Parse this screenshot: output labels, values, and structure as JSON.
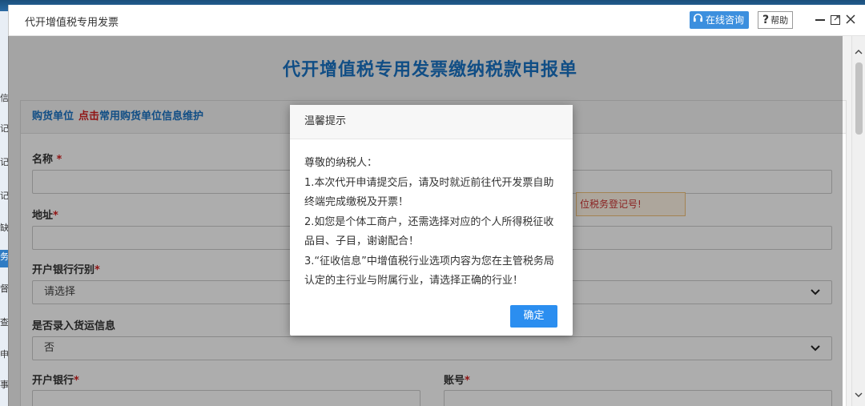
{
  "window": {
    "title": "代开增值税专用发票",
    "consult_label": "在线咨询",
    "help_label": "帮助",
    "help_symbol": "?"
  },
  "form": {
    "title": "代开增值税专用发票缴纳税款申报单",
    "panel_title": "购货单位",
    "panel_link_red": "点击",
    "panel_link": "常用购货单位信息维护",
    "name_label": "名称",
    "address_label": "地址",
    "bank_type_label": "开户银行行别",
    "bank_type_value": "请选择",
    "shipping_label": "是否录入货运信息",
    "shipping_value": "否",
    "bank_label": "开户银行",
    "account_label": "账号",
    "required_mark": "*",
    "warning_text": "位税务登记号!"
  },
  "dialog": {
    "title": "温馨提示",
    "lines": [
      "尊敬的纳税人：",
      "1.本次代开申请提交后，请及时就近前往代开发票自助终端完成缴税及开票！",
      "2.如您是个体工商户，还需选择对应的个人所得税征收品目、子目，谢谢配合！",
      "3.“征收信息”中增值税行业选项内容为您在主管税务局认定的主行业与附属行业，请选择正确的行业！"
    ],
    "ok_label": "确定"
  },
  "background_left": [
    "信",
    "记",
    "记",
    "记",
    "缺",
    "务",
    "督",
    "查",
    "申",
    "事"
  ],
  "colors": {
    "accent": "#1a73c5",
    "required": "#d62020",
    "button": "#2b8ef0"
  },
  "icons": {
    "consult": "headset-icon",
    "minimize": "minimize-icon",
    "restore": "restore-icon",
    "close": "close-icon",
    "dropdown": "chevron-down-icon"
  }
}
